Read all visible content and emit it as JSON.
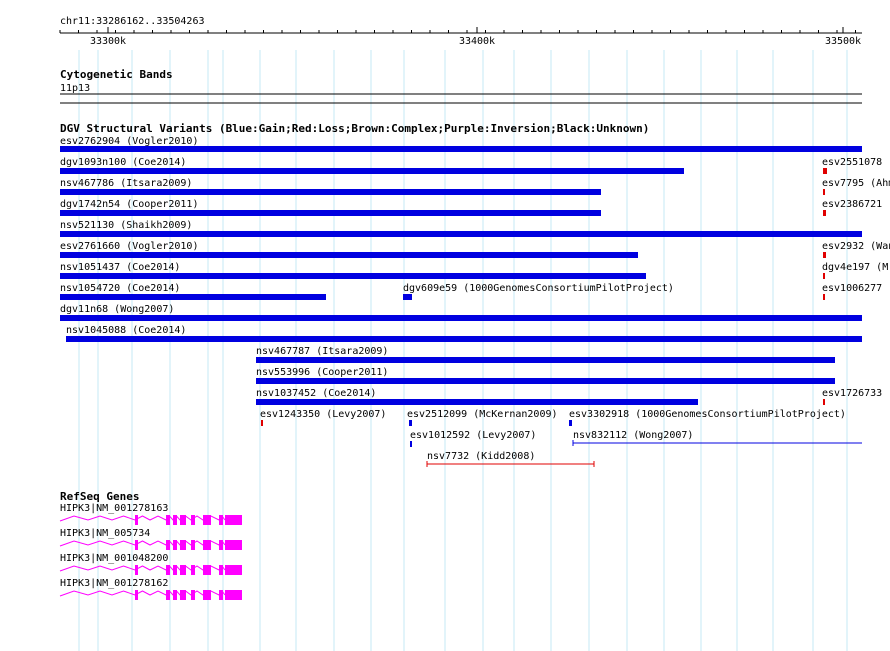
{
  "ruler": {
    "region": "chr11:33286162..33504263",
    "ticks": [
      "33300k",
      "33400k",
      "33500k"
    ]
  },
  "cytoband": {
    "title": "Cytogenetic Bands",
    "band_label": "11p13"
  },
  "dgv": {
    "title": "DGV Structural Variants (Blue:Gain;Red:Loss;Brown:Complex;Purple:Inversion;Black:Unknown)",
    "colors": {
      "gain": "#0000e0",
      "loss": "#e00000",
      "line_blue": "#0000e0",
      "line_red": "#e00000"
    },
    "variants": [
      {
        "label": "esv2762904 (Vogler2010)",
        "type": "gain",
        "shape": "bar"
      },
      {
        "label": "dgv1093n100 (Coe2014)",
        "type": "gain",
        "shape": "bar"
      },
      {
        "label": "nsv467786 (Itsara2009)",
        "type": "gain",
        "shape": "bar"
      },
      {
        "label": "dgv1742n54 (Cooper2011)",
        "type": "gain",
        "shape": "bar"
      },
      {
        "label": "nsv521130 (Shaikh2009)",
        "type": "gain",
        "shape": "bar"
      },
      {
        "label": "esv2761660 (Vogler2010)",
        "type": "gain",
        "shape": "bar"
      },
      {
        "label": "nsv1051437 (Coe2014)",
        "type": "gain",
        "shape": "bar"
      },
      {
        "label": "nsv1054720 (Coe2014)",
        "type": "gain",
        "shape": "bar"
      },
      {
        "label": "dgv609e59 (1000GenomesConsortiumPilotProject)",
        "type": "gain",
        "shape": "bar"
      },
      {
        "label": "dgv11n68 (Wong2007)",
        "type": "gain",
        "shape": "bar"
      },
      {
        "label": "nsv1045088 (Coe2014)",
        "type": "gain",
        "shape": "bar"
      },
      {
        "label": "nsv467787 (Itsara2009)",
        "type": "gain",
        "shape": "bar"
      },
      {
        "label": "nsv553996 (Cooper2011)",
        "type": "gain",
        "shape": "bar"
      },
      {
        "label": "nsv1037452 (Coe2014)",
        "type": "gain",
        "shape": "bar"
      },
      {
        "label": "esv1243350 (Levy2007)",
        "type": "loss",
        "shape": "tick"
      },
      {
        "label": "esv2512099 (McKernan2009)",
        "type": "gain",
        "shape": "tick"
      },
      {
        "label": "esv3302918 (1000GenomesConsortiumPilotProject)",
        "type": "gain",
        "shape": "tick"
      },
      {
        "label": "esv1012592 (Levy2007)",
        "type": "gain",
        "shape": "tick"
      },
      {
        "label": "nsv832112 (Wong2007)",
        "type": "gain",
        "shape": "line"
      },
      {
        "label": "nsv7732 (Kidd2008)",
        "type": "loss",
        "shape": "line"
      },
      {
        "label": "esv2551078 (",
        "type": "loss",
        "shape": "tick"
      },
      {
        "label": "esv7795 (Ahm",
        "type": "loss",
        "shape": "tick"
      },
      {
        "label": "esv2386721",
        "type": "loss",
        "shape": "tick"
      },
      {
        "label": "esv2932 (Wan",
        "type": "loss",
        "shape": "tick"
      },
      {
        "label": "dgv4e197 (M",
        "type": "loss",
        "shape": "tick"
      },
      {
        "label": "esv1006277",
        "type": "loss",
        "shape": "tick"
      },
      {
        "label": "esv1726733",
        "type": "loss",
        "shape": "tick"
      }
    ]
  },
  "refseq": {
    "title": "RefSeq Genes",
    "color": "#ff00ff",
    "genes": [
      {
        "label": "HIPK3|NM_001278163"
      },
      {
        "label": "HIPK3|NM_005734"
      },
      {
        "label": "HIPK3|NM_001048200"
      },
      {
        "label": "HIPK3|NM_001278162"
      }
    ]
  }
}
